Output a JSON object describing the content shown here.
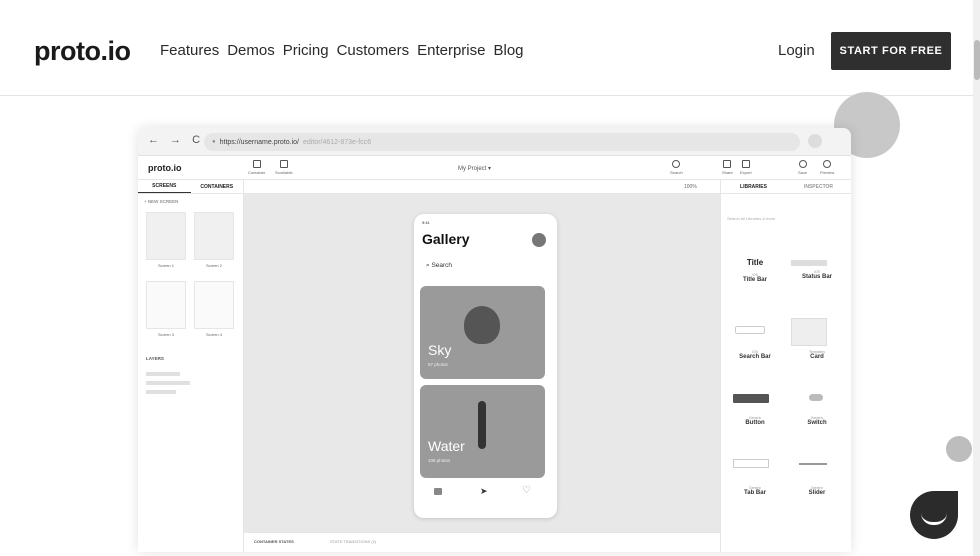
{
  "site": {
    "logo": "proto.io",
    "nav": [
      "Features",
      "Demos",
      "Pricing",
      "Customers",
      "Enterprise",
      "Blog"
    ],
    "login": "Login",
    "cta": "START FOR FREE"
  },
  "browser": {
    "nav_icons": "← → C",
    "url_main": "https://username.proto.io/",
    "url_faded": "editor/4612-873e-fcc6"
  },
  "app": {
    "logo": "proto.io",
    "tools_left": [
      "Container",
      "Scrollable"
    ],
    "project": "My Project ▾",
    "tools_right": [
      "Search",
      "Share",
      "Export",
      "Save",
      "Preview"
    ],
    "sidebar_tabs": [
      "SCREENS",
      "CONTAINERS"
    ],
    "new_screen": "+ NEW SCREEN",
    "screens": [
      "Screen 1",
      "Screen 2",
      "Screen 3",
      "Screen 4"
    ],
    "layers_label": "LAYERS",
    "zoom": "100%",
    "bottom_tabs": [
      "CONTAINER STATES",
      "STATE TRANSITIONS (2)"
    ],
    "right_tabs": [
      "LIBRARIES",
      "INSPECTOR"
    ],
    "search_libs": "Search all Libraries & more",
    "library_items": [
      {
        "preview": "Title",
        "kind": "iOS",
        "name": "Title Bar"
      },
      {
        "preview": "",
        "kind": "iOS",
        "name": "Status Bar"
      },
      {
        "preview": "",
        "kind": "iOS",
        "name": "Search Bar"
      },
      {
        "preview": "",
        "kind": "Templates",
        "name": "Card"
      },
      {
        "preview": "",
        "kind": "Generic",
        "name": "Button"
      },
      {
        "preview": "",
        "kind": "Generic",
        "name": "Switch"
      },
      {
        "preview": "",
        "kind": "Generic",
        "name": "Tab Bar"
      },
      {
        "preview": "",
        "kind": "Generic",
        "name": "Slider"
      }
    ]
  },
  "phone": {
    "time": "9:41",
    "title": "Gallery",
    "search": "Search",
    "cards": [
      {
        "title": "Sky",
        "subtitle": "67 photos"
      },
      {
        "title": "Water",
        "subtitle": "106 photos"
      }
    ]
  }
}
